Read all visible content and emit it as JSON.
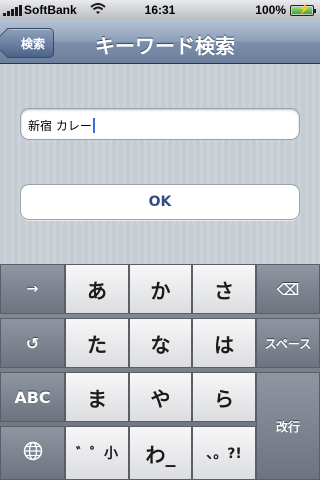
{
  "status_bar": {
    "carrier": "SoftBank",
    "time": "16:31",
    "battery": "100%"
  },
  "nav": {
    "back_label": "検索",
    "title": "キーワード検索"
  },
  "search": {
    "value": "新宿 カレー"
  },
  "ok_button": {
    "label": "OK"
  },
  "keyboard": {
    "row1": [
      "→",
      "あ",
      "か",
      "さ",
      "⌫"
    ],
    "row2": [
      "↺",
      "た",
      "な",
      "は",
      "スペース"
    ],
    "row3": [
      "ABC",
      "ま",
      "や",
      "ら"
    ],
    "row4": [
      "🌐",
      "゛゜小",
      "わ_",
      "、。?!"
    ],
    "enter": "改行"
  },
  "colors": {
    "nav_bar": "#7b8eaa",
    "accent_text": "#324f85",
    "caret": "#3c6bd6"
  }
}
